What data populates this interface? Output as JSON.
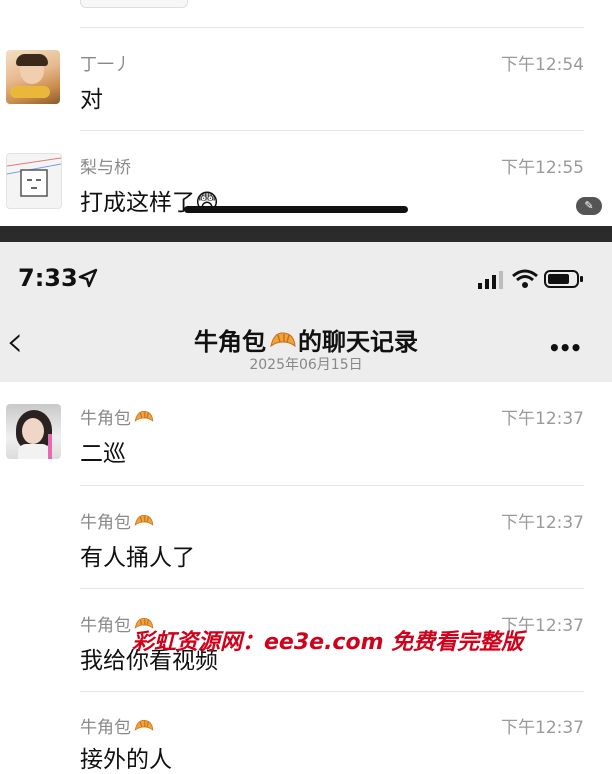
{
  "top_screenshot": {
    "messages": [
      {
        "sender": "丁一丿",
        "time": "下午12:54",
        "text": "对"
      },
      {
        "sender": "梨与桥",
        "time": "下午12:55",
        "text": "打成这样了😨"
      }
    ]
  },
  "status_bar": {
    "time": "7:33"
  },
  "nav": {
    "title": "牛角包🥐的聊天记录",
    "title_text": "牛角包",
    "title_suffix": "的聊天记录",
    "date": "2025年06月15日",
    "more": "•••",
    "back": "‹"
  },
  "chat": {
    "sender": "牛角包🥐",
    "sender_text": "牛角包",
    "messages": [
      {
        "time": "下午12:37",
        "text": "二巡"
      },
      {
        "time": "下午12:37",
        "text": "有人捅人了"
      },
      {
        "time": "下午12:37",
        "text": "我给你看视频"
      },
      {
        "time": "下午12:37",
        "text": "接外的人"
      }
    ]
  },
  "watermark": {
    "text": "彩虹资源网：ee3e.com 免费看完整版",
    "color": "#d0021b"
  },
  "colors": {
    "separator": "#2b2b2b",
    "nav_bg": "#ededed"
  }
}
